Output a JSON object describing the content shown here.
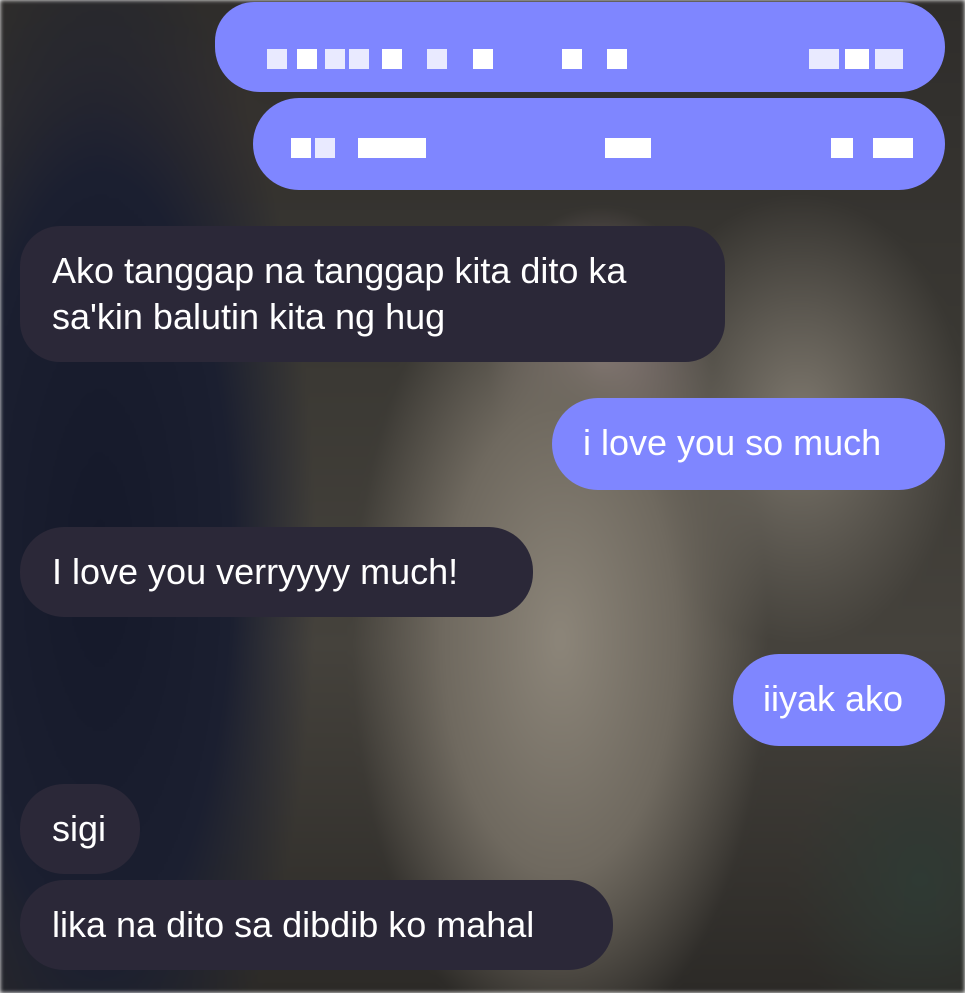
{
  "chat": {
    "messages": [
      {
        "from": "me",
        "text": "",
        "redacted": true
      },
      {
        "from": "me",
        "text": "",
        "redacted": true
      },
      {
        "from": "them",
        "text": "Ako tanggap na tanggap kita dito ka sa'kin balutin kita ng hug"
      },
      {
        "from": "me",
        "text": "i love you so much"
      },
      {
        "from": "them",
        "text": "I love you verryyyy much!"
      },
      {
        "from": "me",
        "text": "iiyak ako"
      },
      {
        "from": "them",
        "text": "sigi"
      },
      {
        "from": "them",
        "text": "lika na dito sa dibdib ko mahal"
      }
    ]
  },
  "colors": {
    "sent_bubble": "#7f86ff",
    "received_bubble": "#2b2838"
  }
}
